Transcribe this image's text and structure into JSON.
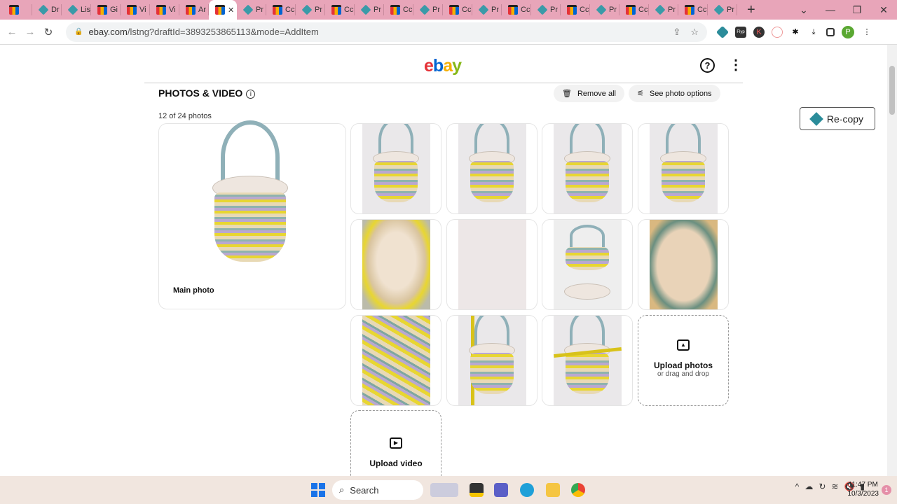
{
  "browser": {
    "tabs": [
      "",
      "Dr",
      "Lis",
      "Gi",
      "Vi",
      "Vi",
      "Ar",
      "",
      "Pr",
      "Cc",
      "Pr",
      "Cc",
      "Pr",
      "Cc",
      "Pr",
      "Cc",
      "Pr",
      "Cc",
      "Pr",
      "Cc",
      "Pr",
      "Cc",
      "Pr",
      "Cc",
      "Pr"
    ],
    "tab_icons": [
      "bag",
      "dia",
      "dia",
      "bag",
      "bag",
      "bag",
      "bag",
      "bag",
      "dia",
      "bag",
      "dia",
      "bag",
      "dia",
      "bag",
      "dia",
      "bag",
      "dia",
      "bag",
      "dia",
      "bag",
      "dia",
      "bag",
      "dia",
      "bag",
      "dia"
    ],
    "active_tab_close": "✕",
    "new_tab": "+",
    "url_host": "ebay.com",
    "url_path": "/lstng?draftId=3893253865113&mode=AddItem",
    "profile_initial": "P"
  },
  "page": {
    "logo": [
      "e",
      "b",
      "a",
      "y"
    ],
    "logo_colors": [
      "#e53238",
      "#0064d2",
      "#f5af02",
      "#86b817"
    ],
    "section_title": "PHOTOS & VIDEO",
    "remove_all": "Remove all",
    "see_photo_options": "See photo options",
    "photo_count": "12 of 24 photos",
    "main_photo_label": "Main photo",
    "upload_photos": "Upload photos",
    "upload_photos_sub": "or drag and drop",
    "upload_video": "Upload video",
    "recopy": "Re-copy"
  },
  "taskbar": {
    "search": "Search",
    "time": "11:47 PM",
    "date": "10/3/2023",
    "notifications": "1"
  }
}
